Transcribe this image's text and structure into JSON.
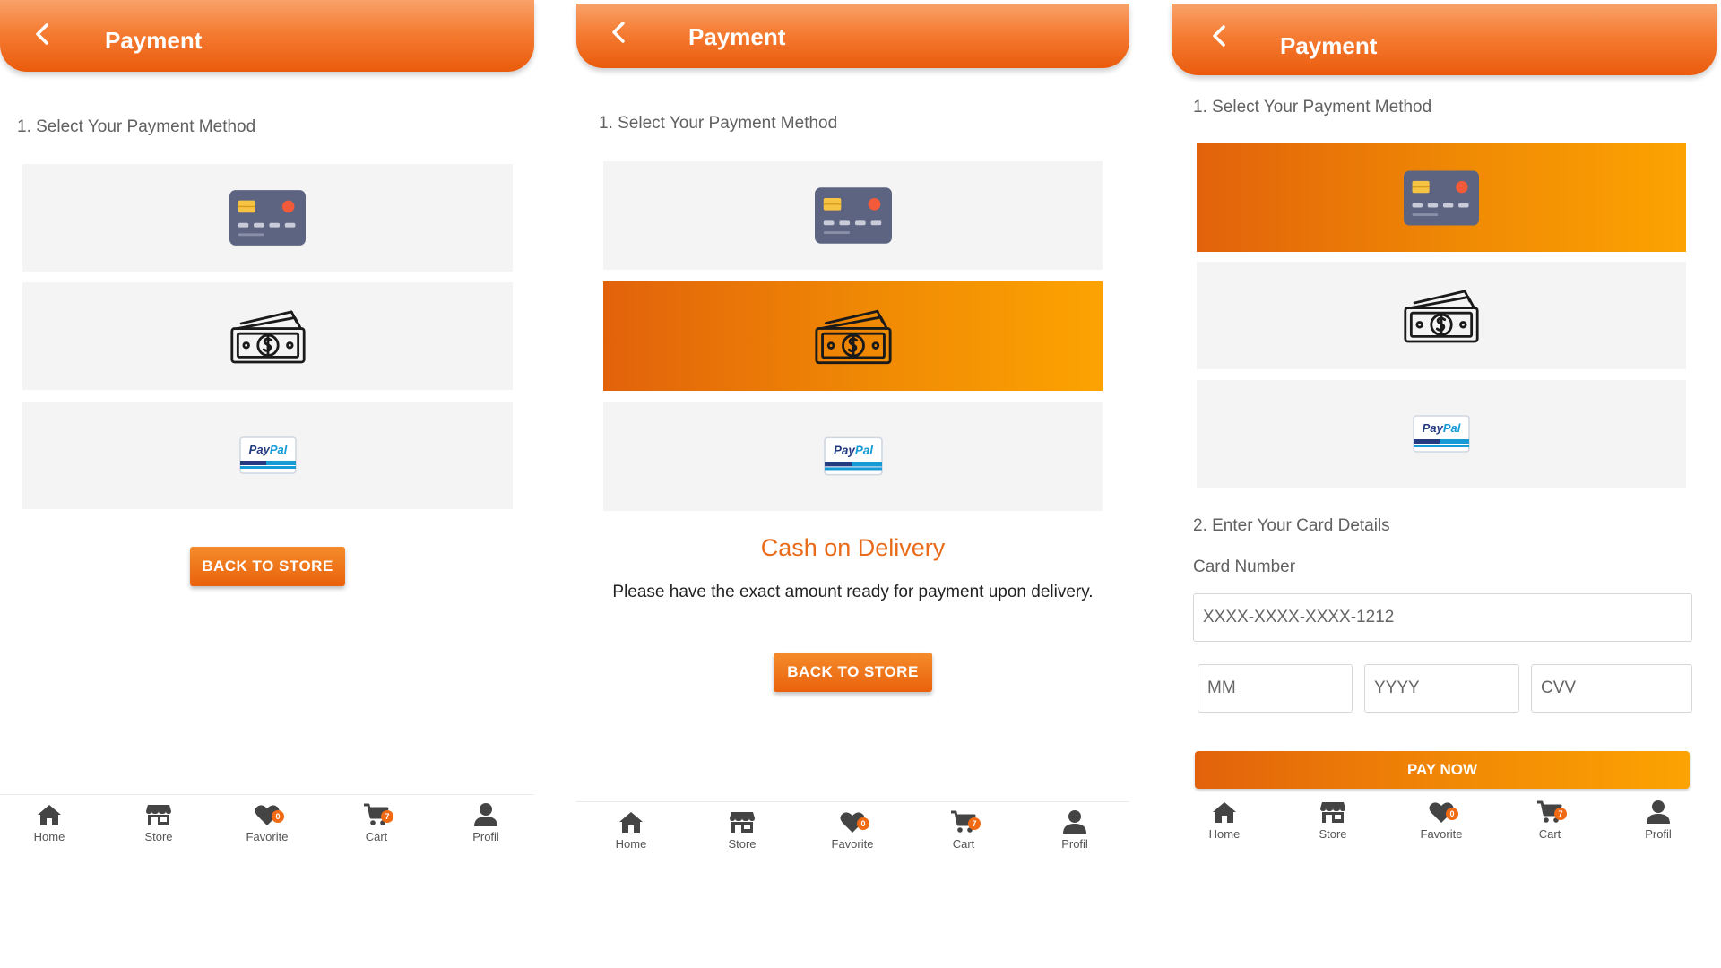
{
  "header": {
    "title": "Payment"
  },
  "labels": {
    "select_method": "1. Select Your Payment Method",
    "card_details": "2. Enter Your Card Details",
    "card_number": "Card Number"
  },
  "buttons": {
    "back_to_store": "BACK TO STORE",
    "pay_now": "PAY NOW"
  },
  "payment_methods": [
    "credit-card",
    "cash",
    "paypal"
  ],
  "paypal_text": "PayPal",
  "screens": [
    {
      "selected_method": "none"
    },
    {
      "selected_method": "cash"
    },
    {
      "selected_method": "credit-card"
    }
  ],
  "cod": {
    "title": "Cash on Delivery",
    "message": "Please have the exact amount ready for payment upon delivery."
  },
  "card_form": {
    "card_number_placeholder": "XXXX-XXXX-XXXX-1212",
    "month_placeholder": "MM",
    "year_placeholder": "YYYY",
    "cvv_placeholder": "CVV"
  },
  "nav": [
    {
      "label": "Home",
      "icon": "home-icon"
    },
    {
      "label": "Store",
      "icon": "store-icon"
    },
    {
      "label": "Favorite",
      "icon": "heart-icon",
      "badge": "0"
    },
    {
      "label": "Cart",
      "icon": "cart-icon",
      "badge": "7"
    },
    {
      "label": "Profil",
      "icon": "profile-icon"
    }
  ],
  "colors": {
    "accent": "#f07a1e",
    "accent_dark": "#e2620b",
    "accent_light": "#fca302",
    "tile_bg": "#f4f4f4"
  }
}
